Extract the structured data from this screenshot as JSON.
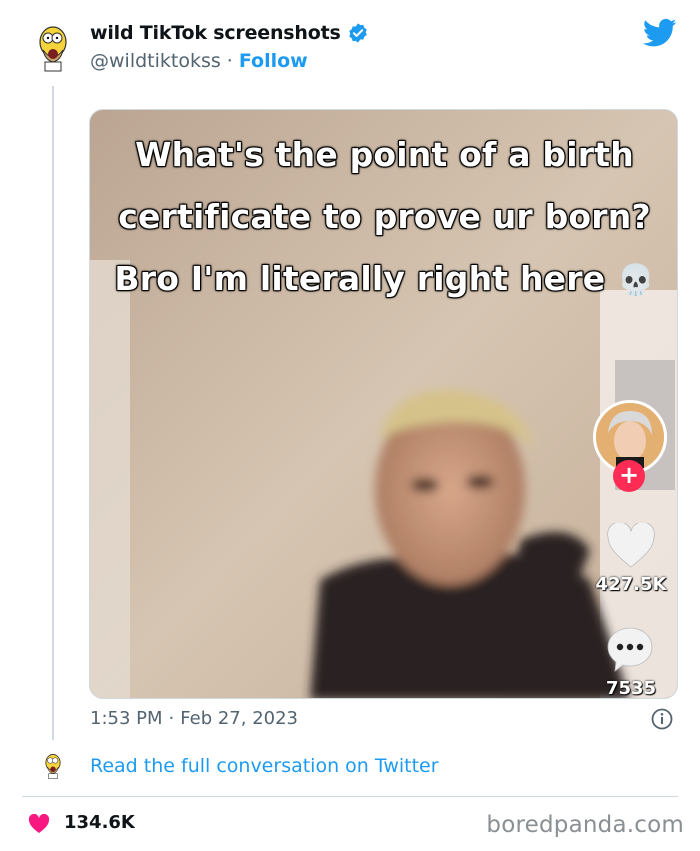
{
  "tweet": {
    "author_name": "wild TikTok screenshots",
    "handle": "@wildtiktokss",
    "separator": "·",
    "follow_label": "Follow",
    "time": "1:53 PM",
    "date": "Feb 27, 2023",
    "read_more": "Read the full conversation on Twitter",
    "likes": "134.6K"
  },
  "tiktok": {
    "caption": "What's the point of a birth certificate to prove ur born? Bro I'm literally right here",
    "caption_emoji": "💀",
    "plus": "+",
    "like_count": "427.5K",
    "comment_count": "7535"
  },
  "watermark": "boredpanda.com",
  "icons": {
    "avatar": "homer-avatar-icon",
    "verified": "verified-badge-icon",
    "brand": "twitter-bird-icon",
    "like": "heart-icon",
    "comment": "comment-bubble-icon",
    "info": "info-icon"
  },
  "colors": {
    "accent": "#1d9bf0",
    "text": "#0f1419",
    "muted": "#536471",
    "heart": "#f91880",
    "tiktok_red": "#fe2c55"
  }
}
